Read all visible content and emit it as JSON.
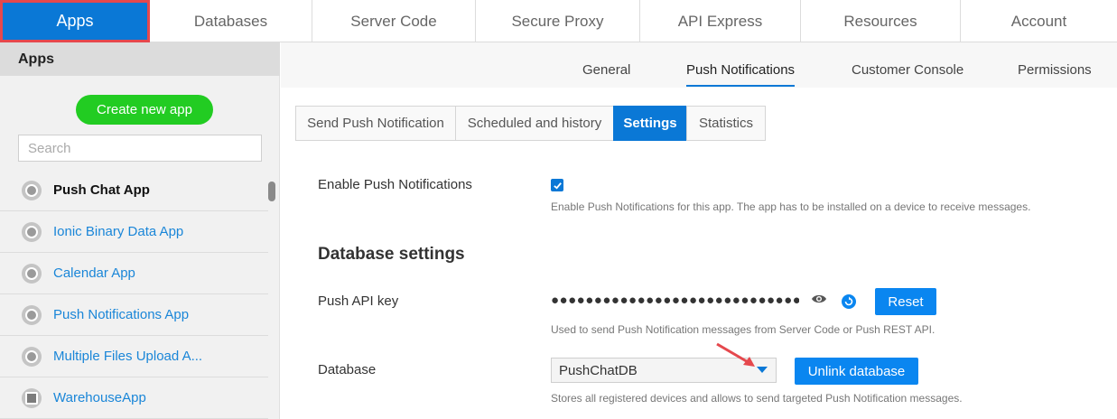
{
  "topnav": {
    "tabs": [
      {
        "label": "Apps",
        "active": true
      },
      {
        "label": "Databases"
      },
      {
        "label": "Server Code"
      },
      {
        "label": "Secure Proxy"
      },
      {
        "label": "API Express"
      },
      {
        "label": "Resources"
      },
      {
        "label": "Account"
      }
    ]
  },
  "sidebar": {
    "title": "Apps",
    "create_button": "Create new app",
    "search_placeholder": "Search",
    "apps": [
      {
        "label": "Push Chat App",
        "selected": true
      },
      {
        "label": "Ionic Binary Data App"
      },
      {
        "label": "Calendar App"
      },
      {
        "label": "Push Notifications App"
      },
      {
        "label": "Multiple Files Upload A..."
      },
      {
        "label": "WarehouseApp"
      }
    ]
  },
  "subnav": {
    "tabs": [
      {
        "label": "General"
      },
      {
        "label": "Push Notifications",
        "active": true
      },
      {
        "label": "Customer Console"
      },
      {
        "label": "Permissions"
      }
    ]
  },
  "tabbar": {
    "tabs": [
      {
        "label": "Send Push Notification"
      },
      {
        "label": "Scheduled and history"
      },
      {
        "label": "Settings",
        "active": true
      },
      {
        "label": "Statistics"
      }
    ]
  },
  "settings": {
    "enable_label": "Enable Push Notifications",
    "enable_checked": true,
    "enable_help": "Enable Push Notifications for this app. The app has to be installed on a device to receive messages.",
    "db_section_title": "Database settings",
    "api_key_label": "Push API key",
    "api_key_value": "●●●●●●●●●●●●●●●●●●●●●●●●●●●●●●●● ...",
    "reset_label": "Reset",
    "api_key_help": "Used to send Push Notification messages from Server Code or Push REST API.",
    "database_label": "Database",
    "database_value": "PushChatDB",
    "unlink_label": "Unlink database",
    "database_help": "Stores all registered devices and allows to send targeted Push Notification messages."
  },
  "colors": {
    "accent": "#0a78d6",
    "create_button": "#22cc22",
    "highlight_border": "#e5484d"
  }
}
